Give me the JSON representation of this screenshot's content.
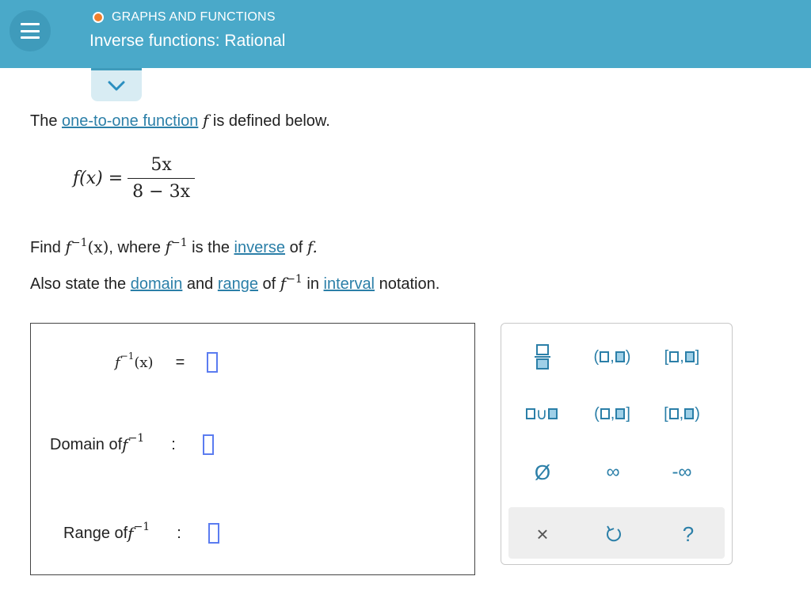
{
  "header": {
    "topic": "GRAPHS AND FUNCTIONS",
    "title": "Inverse functions: Rational"
  },
  "problem": {
    "intro_pre": "The ",
    "intro_link": "one-to-one function",
    "intro_f": "f",
    "intro_post": " is defined below.",
    "func_lhs": "f(x) =",
    "func_num": "5x",
    "func_den": "8 − 3x",
    "find_pre": "Find ",
    "find_f": "f",
    "sup": "−1",
    "find_x": "(x)",
    "find_mid": ", where ",
    "find_mid2": " is the ",
    "inverse_link": "inverse",
    "find_of": " of ",
    "find_end": "f.",
    "also_pre": "Also state the ",
    "domain_link": "domain",
    "also_and": " and ",
    "range_link": "range",
    "also_of": " of ",
    "also_in": " in ",
    "interval_link": "interval",
    "also_end": " notation."
  },
  "answer": {
    "row1_eq": "=",
    "domain_label": "Domain of ",
    "range_label": "Range of ",
    "colon": ":"
  },
  "palette": {
    "keys": [
      "(□,□)",
      "[□,□]",
      "(□,□]",
      "[□,□)",
      "∅",
      "∞",
      "-∞",
      "×",
      "↺",
      "?"
    ],
    "union": "∪",
    "empty_set": "Ø",
    "infinity": "∞",
    "neg_infinity": "-∞",
    "clear": "×",
    "undo": "↺",
    "help": "?"
  },
  "colors": {
    "header": "#4aa9c9",
    "link": "#2b7fa8",
    "accent_orange": "#f07f2c",
    "blank_border": "#5b7cf0"
  }
}
